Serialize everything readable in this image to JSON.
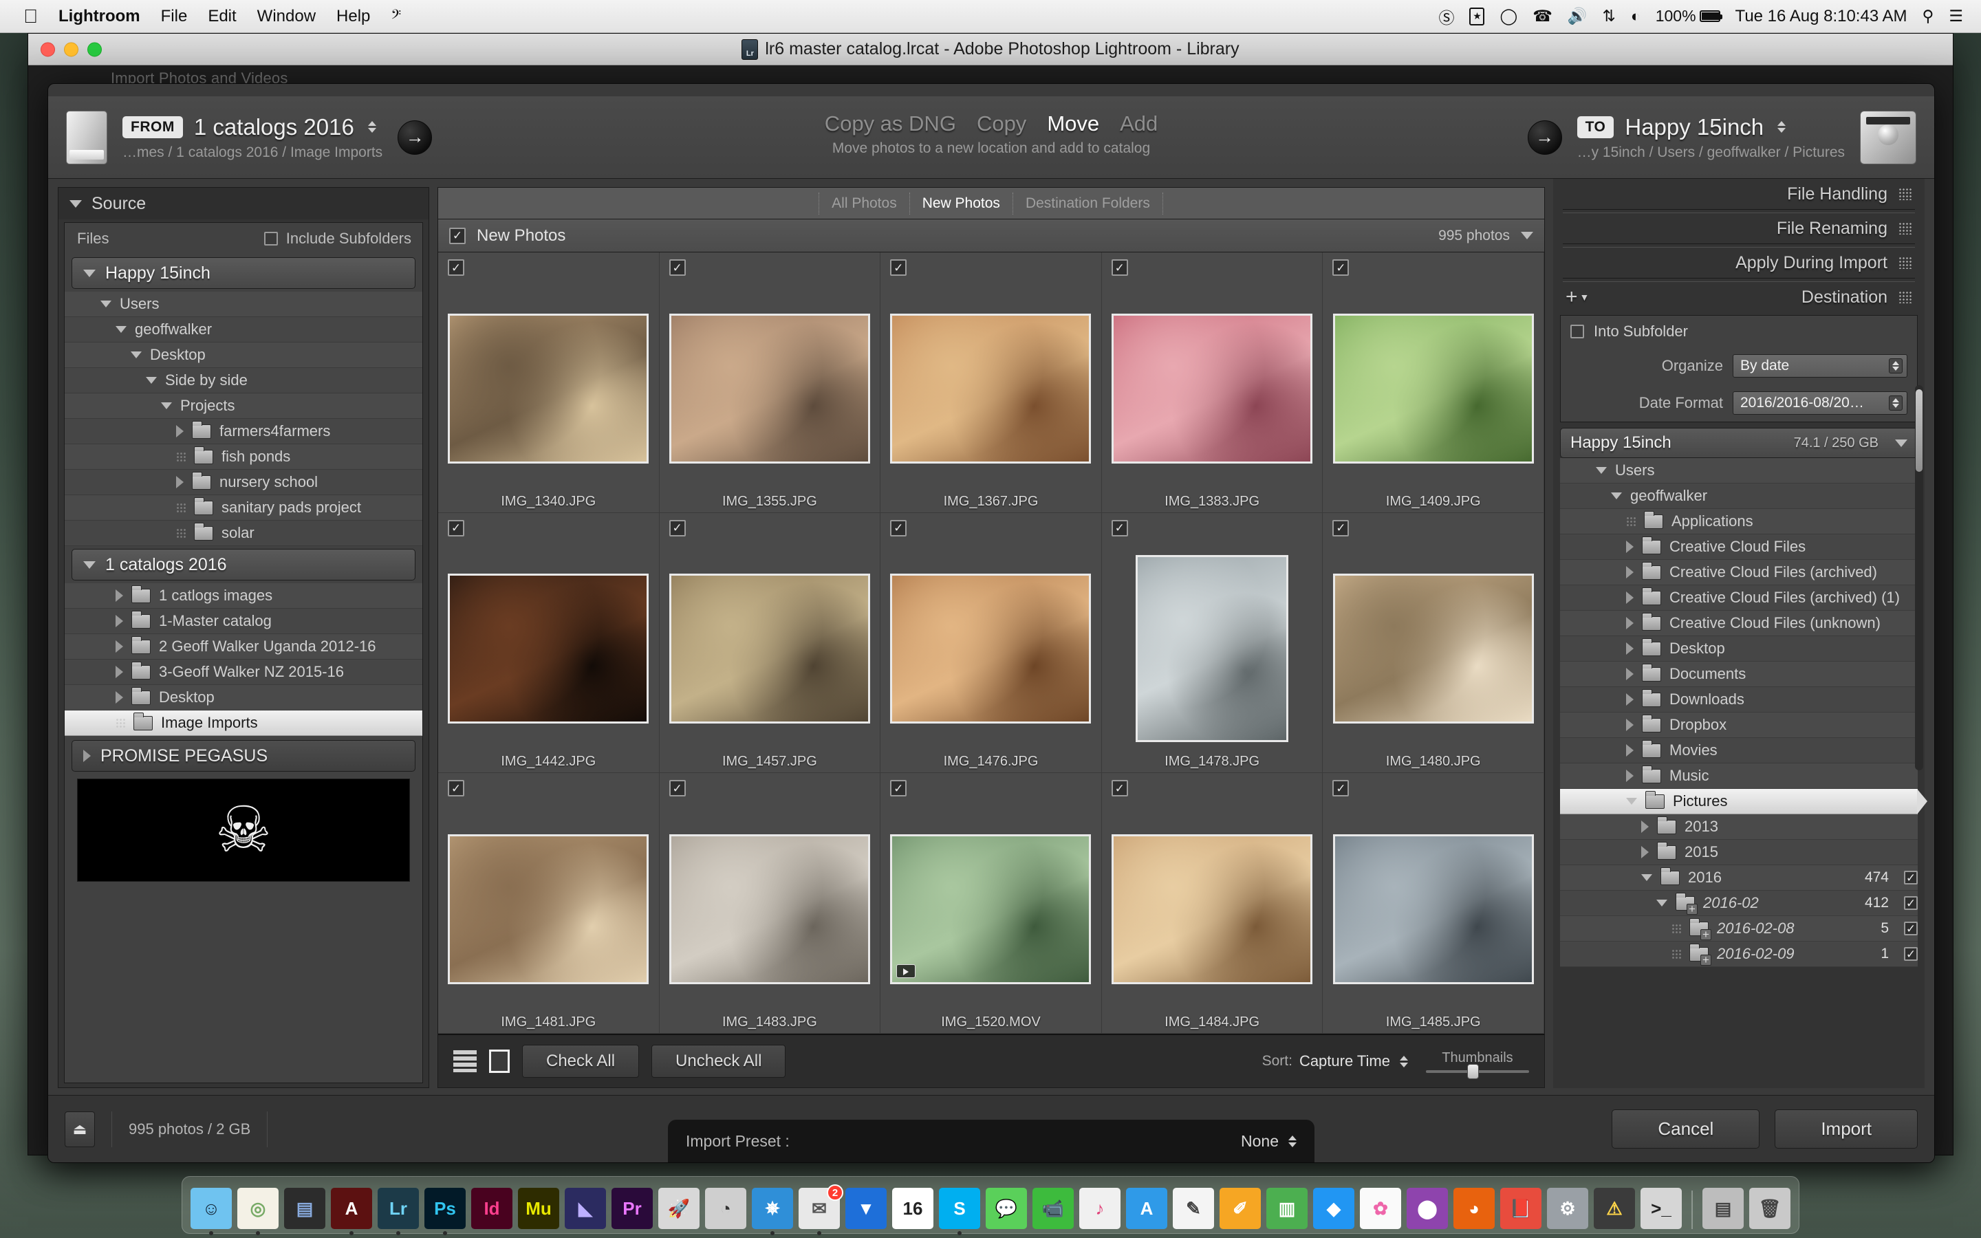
{
  "menubar": {
    "apple": "",
    "items": [
      "Lightroom",
      "File",
      "Edit",
      "Window",
      "Help"
    ],
    "app_name": "Lightroom",
    "extra_glyph": "𝄞",
    "status_icons": [
      "nortonlike-icon",
      "bookmark-icon",
      "clock-icon",
      "phone-icon",
      "volume-icon",
      "bluetooth-icon",
      "wifi-icon"
    ],
    "battery_percent": "100%",
    "clock": "Tue 16 Aug  8:10:43 AM",
    "search_glyph": "⌕",
    "list_glyph": "☰"
  },
  "window": {
    "title": "lr6 master catalog.lrcat - Adobe Photoshop Lightroom - Library",
    "catalog_badge": "Lr",
    "ghost_title": "Import Photos and Videos"
  },
  "header": {
    "from_chip": "FROM",
    "from_name": "1 catalogs 2016",
    "from_path": "…mes / 1 catalogs 2016 / Image Imports",
    "modes": [
      {
        "label": "Copy as DNG",
        "active": false
      },
      {
        "label": "Copy",
        "active": false
      },
      {
        "label": "Move",
        "active": true
      },
      {
        "label": "Add",
        "active": false
      }
    ],
    "mode_description": "Move photos to a new location and add to catalog",
    "to_chip": "TO",
    "to_name": "Happy 15inch",
    "to_path": "…y 15inch / Users / geoffwalker / Pictures"
  },
  "source": {
    "panel_title": "Source",
    "files_label": "Files",
    "include_subfolders_label": "Include Subfolders",
    "include_subfolders_checked": false,
    "volume1": "Happy 15inch",
    "tree1": [
      {
        "label": "Users",
        "indent": 1,
        "twisty": "down",
        "folder": false
      },
      {
        "label": "geoffwalker",
        "indent": 2,
        "twisty": "down",
        "folder": false
      },
      {
        "label": "Desktop",
        "indent": 3,
        "twisty": "down",
        "folder": false
      },
      {
        "label": "Side by side",
        "indent": 4,
        "twisty": "down",
        "folder": false
      },
      {
        "label": "Projects",
        "indent": 5,
        "twisty": "down",
        "folder": false
      },
      {
        "label": "farmers4farmers",
        "indent": 6,
        "twisty": "right",
        "folder": true
      },
      {
        "label": "fish ponds",
        "indent": 6,
        "twisty": "dots",
        "folder": true
      },
      {
        "label": "nursery school",
        "indent": 6,
        "twisty": "right",
        "folder": true
      },
      {
        "label": "sanitary pads project",
        "indent": 6,
        "twisty": "dots",
        "folder": true
      },
      {
        "label": "solar",
        "indent": 6,
        "twisty": "dots",
        "folder": true
      }
    ],
    "volume2": "1 catalogs 2016",
    "tree2": [
      {
        "label": "1 catlogs images",
        "indent": 2,
        "twisty": "right",
        "folder": true,
        "selected": false
      },
      {
        "label": "1-Master catalog",
        "indent": 2,
        "twisty": "right",
        "folder": true,
        "selected": false
      },
      {
        "label": "2 Geoff Walker Uganda 2012-16",
        "indent": 2,
        "twisty": "right",
        "folder": true,
        "selected": false
      },
      {
        "label": "3-Geoff Walker NZ 2015-16",
        "indent": 2,
        "twisty": "right",
        "folder": true,
        "selected": false
      },
      {
        "label": "Desktop",
        "indent": 2,
        "twisty": "right",
        "folder": true,
        "selected": false
      },
      {
        "label": "Image Imports",
        "indent": 2,
        "twisty": "dots",
        "folder": true,
        "selected": true
      }
    ],
    "volume3": "PROMISE PEGASUS",
    "preview_icon": "skull-and-crossbones"
  },
  "center": {
    "segments": [
      {
        "label": "All Photos",
        "active": false
      },
      {
        "label": "New Photos",
        "active": true
      },
      {
        "label": "Destination Folders",
        "active": false
      }
    ],
    "grid_header_label": "New Photos",
    "grid_header_checked": true,
    "photo_count": "995 photos",
    "cells": [
      {
        "filename": "IMG_1340.JPG",
        "checked": true,
        "orientation": "landscape",
        "video": false
      },
      {
        "filename": "IMG_1355.JPG",
        "checked": true,
        "orientation": "landscape",
        "video": false
      },
      {
        "filename": "IMG_1367.JPG",
        "checked": true,
        "orientation": "landscape",
        "video": false
      },
      {
        "filename": "IMG_1383.JPG",
        "checked": true,
        "orientation": "landscape",
        "video": false
      },
      {
        "filename": "IMG_1409.JPG",
        "checked": true,
        "orientation": "landscape",
        "video": false
      },
      {
        "filename": "IMG_1442.JPG",
        "checked": true,
        "orientation": "landscape",
        "video": false
      },
      {
        "filename": "IMG_1457.JPG",
        "checked": true,
        "orientation": "landscape",
        "video": false
      },
      {
        "filename": "IMG_1476.JPG",
        "checked": true,
        "orientation": "landscape",
        "video": false
      },
      {
        "filename": "IMG_1478.JPG",
        "checked": true,
        "orientation": "portrait",
        "video": false
      },
      {
        "filename": "IMG_1480.JPG",
        "checked": true,
        "orientation": "landscape",
        "video": false
      },
      {
        "filename": "IMG_1481.JPG",
        "checked": true,
        "orientation": "landscape",
        "video": false
      },
      {
        "filename": "IMG_1483.JPG",
        "checked": true,
        "orientation": "landscape",
        "video": false
      },
      {
        "filename": "IMG_1520.MOV",
        "checked": true,
        "orientation": "landscape",
        "video": true
      },
      {
        "filename": "IMG_1484.JPG",
        "checked": true,
        "orientation": "landscape",
        "video": false
      },
      {
        "filename": "IMG_1485.JPG",
        "checked": true,
        "orientation": "landscape",
        "video": false
      }
    ],
    "toolbar": {
      "check_all": "Check All",
      "uncheck_all": "Uncheck All",
      "sort_label": "Sort:",
      "sort_value": "Capture Time",
      "thumbnails_label": "Thumbnails"
    }
  },
  "right": {
    "sections": [
      {
        "title": "File Handling",
        "expanded": false
      },
      {
        "title": "File Renaming",
        "expanded": false
      },
      {
        "title": "Apply During Import",
        "expanded": false
      },
      {
        "title": "Destination",
        "expanded": true
      }
    ],
    "destination": {
      "into_subfolder_label": "Into Subfolder",
      "into_subfolder_checked": false,
      "organize_label": "Organize",
      "organize_value": "By date",
      "date_format_label": "Date Format",
      "date_format_value": "2016/2016-08/20…",
      "volume": "Happy 15inch",
      "capacity": "74.1 / 250 GB",
      "tree": [
        {
          "label": "Users",
          "indent": 1,
          "twisty": "down",
          "folder": false,
          "count": "",
          "checked": null,
          "italic": false,
          "selected": false
        },
        {
          "label": "geoffwalker",
          "indent": 2,
          "twisty": "down",
          "folder": false,
          "count": "",
          "checked": null,
          "italic": false,
          "selected": false
        },
        {
          "label": "Applications",
          "indent": 3,
          "twisty": "dots",
          "folder": true,
          "count": "",
          "checked": null,
          "italic": false,
          "selected": false
        },
        {
          "label": "Creative Cloud Files",
          "indent": 3,
          "twisty": "right",
          "folder": true,
          "count": "",
          "checked": null,
          "italic": false,
          "selected": false
        },
        {
          "label": "Creative Cloud Files (archived)",
          "indent": 3,
          "twisty": "right",
          "folder": true,
          "count": "",
          "checked": null,
          "italic": false,
          "selected": false
        },
        {
          "label": "Creative Cloud Files (archived) (1)",
          "indent": 3,
          "twisty": "right",
          "folder": true,
          "count": "",
          "checked": null,
          "italic": false,
          "selected": false
        },
        {
          "label": "Creative Cloud Files (unknown)",
          "indent": 3,
          "twisty": "right",
          "folder": true,
          "count": "",
          "checked": null,
          "italic": false,
          "selected": false
        },
        {
          "label": "Desktop",
          "indent": 3,
          "twisty": "right",
          "folder": true,
          "count": "",
          "checked": null,
          "italic": false,
          "selected": false
        },
        {
          "label": "Documents",
          "indent": 3,
          "twisty": "right",
          "folder": true,
          "count": "",
          "checked": null,
          "italic": false,
          "selected": false
        },
        {
          "label": "Downloads",
          "indent": 3,
          "twisty": "right",
          "folder": true,
          "count": "",
          "checked": null,
          "italic": false,
          "selected": false
        },
        {
          "label": "Dropbox",
          "indent": 3,
          "twisty": "right",
          "folder": true,
          "count": "",
          "checked": null,
          "italic": false,
          "selected": false
        },
        {
          "label": "Movies",
          "indent": 3,
          "twisty": "right",
          "folder": true,
          "count": "",
          "checked": null,
          "italic": false,
          "selected": false
        },
        {
          "label": "Music",
          "indent": 3,
          "twisty": "right",
          "folder": true,
          "count": "",
          "checked": null,
          "italic": false,
          "selected": false
        },
        {
          "label": "Pictures",
          "indent": 3,
          "twisty": "down",
          "folder": true,
          "count": "",
          "checked": null,
          "italic": false,
          "selected": true
        },
        {
          "label": "2013",
          "indent": 4,
          "twisty": "right",
          "folder": true,
          "count": "",
          "checked": null,
          "italic": false,
          "selected": false
        },
        {
          "label": "2015",
          "indent": 4,
          "twisty": "right",
          "folder": true,
          "count": "",
          "checked": null,
          "italic": false,
          "selected": false
        },
        {
          "label": "2016",
          "indent": 4,
          "twisty": "down",
          "folder": true,
          "count": "474",
          "checked": true,
          "italic": false,
          "selected": false
        },
        {
          "label": "2016-02",
          "indent": 5,
          "twisty": "down",
          "folder": "plus",
          "count": "412",
          "checked": true,
          "italic": true,
          "selected": false
        },
        {
          "label": "2016-02-08",
          "indent": 6,
          "twisty": "dots",
          "folder": "plus",
          "count": "5",
          "checked": true,
          "italic": true,
          "selected": false
        },
        {
          "label": "2016-02-09",
          "indent": 6,
          "twisty": "dots",
          "folder": "plus",
          "count": "1",
          "checked": true,
          "italic": true,
          "selected": false
        }
      ]
    }
  },
  "bottom": {
    "eject_glyph": "⏏",
    "status": "995 photos / 2 GB",
    "import_preset_label": "Import Preset :",
    "import_preset_value": "None",
    "cancel": "Cancel",
    "import": "Import"
  },
  "dock": {
    "items": [
      {
        "name": "finder",
        "label": "☺",
        "bg": "#6fc3f0",
        "fg": "#123",
        "running": true
      },
      {
        "name": "maps",
        "label": "◎",
        "bg": "#f4f1e6",
        "fg": "#7a6",
        "running": true
      },
      {
        "name": "keynote-ish",
        "label": "▤",
        "bg": "#2c2c2c",
        "fg": "#8ad",
        "running": false
      },
      {
        "name": "acrobat",
        "label": "A",
        "bg": "#5c1111",
        "fg": "#fff",
        "running": true
      },
      {
        "name": "lightroom",
        "label": "Lr",
        "bg": "#1c3a48",
        "fg": "#6fd3f5",
        "running": true
      },
      {
        "name": "photoshop",
        "label": "Ps",
        "bg": "#021a28",
        "fg": "#31c5f0",
        "running": true
      },
      {
        "name": "indesign",
        "label": "Id",
        "bg": "#49021f",
        "fg": "#ff3f8e",
        "running": false
      },
      {
        "name": "muse",
        "label": "Mu",
        "bg": "#2e2c00",
        "fg": "#e8e800",
        "running": false
      },
      {
        "name": "edge-animate",
        "label": "◣",
        "bg": "#2b2b60",
        "fg": "#bdb0ff",
        "running": false
      },
      {
        "name": "premiere",
        "label": "Pr",
        "bg": "#2a0a3a",
        "fg": "#ea77ff",
        "running": false
      },
      {
        "name": "launchpad",
        "label": "🚀",
        "bg": "#d8d8d8",
        "fg": "#333",
        "running": false
      },
      {
        "name": "image-capture",
        "label": "◔",
        "bg": "#cfcfcf",
        "fg": "#333",
        "running": false
      },
      {
        "name": "safari",
        "label": "✵",
        "bg": "#2f8fd8",
        "fg": "#fff",
        "running": true
      },
      {
        "name": "mail",
        "label": "✉",
        "bg": "#e8e8e8",
        "fg": "#555",
        "running": true,
        "badge": "2"
      },
      {
        "name": "dropbox",
        "label": "▼",
        "bg": "#1e6fd9",
        "fg": "#fff",
        "running": false
      },
      {
        "name": "calendar",
        "label": "16",
        "bg": "#ffffff",
        "fg": "#222",
        "running": false
      },
      {
        "name": "skype",
        "label": "S",
        "bg": "#00aff0",
        "fg": "#fff",
        "running": true
      },
      {
        "name": "messages",
        "label": "💬",
        "bg": "#5ad05a",
        "fg": "#fff",
        "running": false
      },
      {
        "name": "facetime",
        "label": "📹",
        "bg": "#3dbb3d",
        "fg": "#fff",
        "running": false
      },
      {
        "name": "itunes",
        "label": "♪",
        "bg": "#f0f0f0",
        "fg": "#e0457b",
        "running": false
      },
      {
        "name": "appstore",
        "label": "A",
        "bg": "#2f9ae8",
        "fg": "#fff",
        "running": false
      },
      {
        "name": "textedit",
        "label": "✎",
        "bg": "#f4f4f4",
        "fg": "#444",
        "running": false
      },
      {
        "name": "pages",
        "label": "✐",
        "bg": "#f6a623",
        "fg": "#fff",
        "running": false
      },
      {
        "name": "numbers",
        "label": "▥",
        "bg": "#4caf50",
        "fg": "#fff",
        "running": false
      },
      {
        "name": "keynote",
        "label": "◆",
        "bg": "#2196f3",
        "fg": "#fff",
        "running": false
      },
      {
        "name": "photos",
        "label": "✿",
        "bg": "#fafafa",
        "fg": "#e6a",
        "running": false
      },
      {
        "name": "utility",
        "label": "⬤",
        "bg": "#8e44ad",
        "fg": "#fff",
        "running": false
      },
      {
        "name": "firefox",
        "label": "◕",
        "bg": "#e8620e",
        "fg": "#fff",
        "running": false
      },
      {
        "name": "books",
        "label": "📕",
        "bg": "#e84c3d",
        "fg": "#fff",
        "running": false
      },
      {
        "name": "system-prefs",
        "label": "⚙",
        "bg": "#9aa0a6",
        "fg": "#fff",
        "running": false
      },
      {
        "name": "warning-app",
        "label": "⚠",
        "bg": "#3b3b3b",
        "fg": "#ffd54a",
        "running": false
      },
      {
        "name": "terminal",
        "label": ">_",
        "bg": "#d6d6d6",
        "fg": "#222",
        "running": false
      },
      {
        "name": "documents-stack",
        "label": "▤",
        "bg": "#bdbdbd",
        "fg": "#444",
        "running": false
      },
      {
        "name": "trash",
        "label": "🗑",
        "bg": "#c9c9c9",
        "fg": "#444",
        "running": false
      }
    ]
  }
}
